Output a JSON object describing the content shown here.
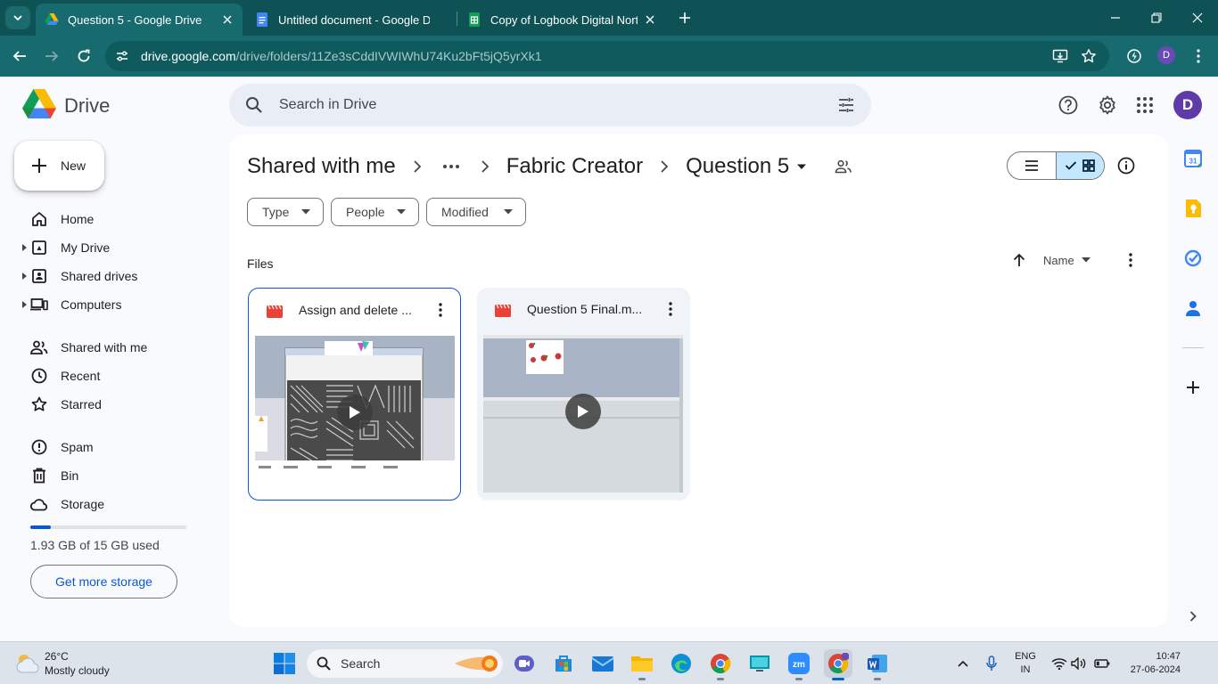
{
  "browser": {
    "tabs": [
      {
        "title": "Question 5 - Google Drive",
        "active": true
      },
      {
        "title": "Untitled document - Google Do",
        "active": false
      },
      {
        "title": "Copy of Logbook Digital North",
        "active": false
      }
    ],
    "url_host": "drive.google.com",
    "url_path": "/drive/folders/11Ze3sCddIVWIWhU74Ku2bFt5jQ5yrXk1",
    "profile_initial": "D"
  },
  "header": {
    "brand": "Drive",
    "search_placeholder": "Search in Drive",
    "avatar_initial": "D"
  },
  "sidebar": {
    "new_label": "New",
    "items": [
      {
        "label": "Home",
        "icon": "home-icon"
      },
      {
        "label": "My Drive",
        "icon": "my-drive-icon"
      },
      {
        "label": "Shared drives",
        "icon": "shared-drives-icon"
      },
      {
        "label": "Computers",
        "icon": "computers-icon"
      },
      {
        "label": "Shared with me",
        "icon": "people-icon"
      },
      {
        "label": "Recent",
        "icon": "clock-icon"
      },
      {
        "label": "Starred",
        "icon": "star-icon"
      },
      {
        "label": "Spam",
        "icon": "spam-icon"
      },
      {
        "label": "Bin",
        "icon": "trash-icon"
      },
      {
        "label": "Storage",
        "icon": "cloud-icon"
      }
    ],
    "storage_text": "1.93 GB of 15 GB used",
    "storage_fraction": 0.129,
    "get_storage_label": "Get more storage"
  },
  "main": {
    "breadcrumbs": [
      "Shared with me",
      "Fabric Creator",
      "Question 5"
    ],
    "filters": [
      "Type",
      "People",
      "Modified"
    ],
    "files_label": "Files",
    "sort_label": "Name",
    "files": [
      {
        "name": "Assign and delete ...",
        "type": "video",
        "selected": true
      },
      {
        "name": "Question 5 Final.m...",
        "type": "video",
        "selected": false
      }
    ]
  },
  "taskbar": {
    "weather_temp": "26°C",
    "weather_desc": "Mostly cloudy",
    "search_label": "Search",
    "lang_line1": "ENG",
    "lang_line2": "IN",
    "time": "10:47",
    "date": "27-06-2024"
  },
  "colors": {
    "chrome_teal": "#0e5255",
    "accent_blue": "#0b57d0",
    "selected_view": "#c2e7ff"
  }
}
